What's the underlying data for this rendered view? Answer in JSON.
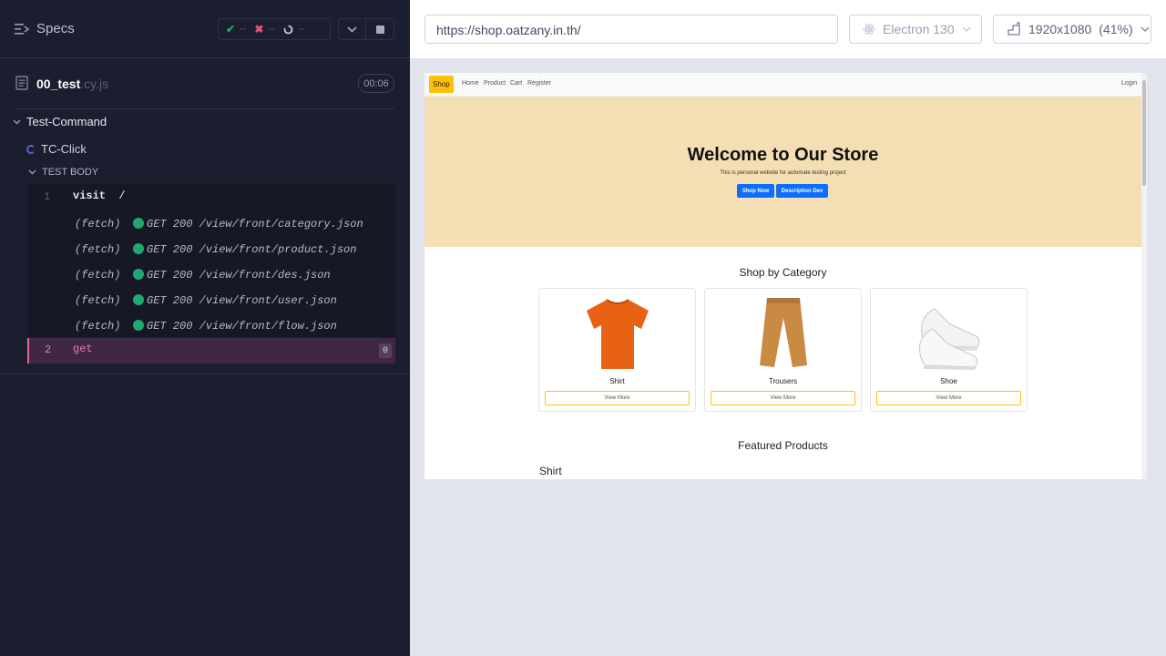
{
  "reporter": {
    "specs_label": "Specs",
    "stats": {
      "passed": "--",
      "failed": "--",
      "pending": "--"
    },
    "spec_file": {
      "name": "00_test",
      "ext": ".cy.js",
      "duration": "00:06"
    },
    "suite": "Test-Command",
    "test": "TC-Click",
    "body_label": "TEST BODY",
    "commands": [
      {
        "num": "1",
        "name": "visit",
        "arg": "/"
      },
      {
        "num": "2",
        "name": "get",
        "count": "0"
      }
    ],
    "fetches": [
      {
        "label": "(fetch)",
        "message": "GET 200 /view/front/category.json"
      },
      {
        "label": "(fetch)",
        "message": "GET 200 /view/front/product.json"
      },
      {
        "label": "(fetch)",
        "message": "GET 200 /view/front/des.json"
      },
      {
        "label": "(fetch)",
        "message": "GET 200 /view/front/user.json"
      },
      {
        "label": "(fetch)",
        "message": "GET 200 /view/front/flow.json"
      }
    ]
  },
  "aut_bar": {
    "url": "https://shop.oatzany.in.th/",
    "browser": "Electron 130",
    "viewport": "1920x1080",
    "zoom": "(41%)"
  },
  "site": {
    "brand": "Shop",
    "nav": [
      "Home",
      "Product",
      "Cart",
      "Register"
    ],
    "login": "Login",
    "hero_title": "Welcome to Our Store",
    "hero_subtitle": "This is personal website for automate testing project",
    "hero_buttons": [
      "Shop Now",
      "Description Dev"
    ],
    "category_title": "Shop by Category",
    "categories": [
      {
        "name": "Shirt",
        "button": "View More"
      },
      {
        "name": "Trousers",
        "button": "View More"
      },
      {
        "name": "Shoe",
        "button": "View More"
      }
    ],
    "featured_title": "Featured Products",
    "featured_first": "Shirt"
  },
  "colors": {
    "reporter_bg": "#1b1e2e",
    "pass": "#1fa971",
    "fail": "#e45770",
    "hero_bg": "#f4deb4",
    "brand_bg": "#ffc107",
    "primary": "#0d6efd"
  }
}
